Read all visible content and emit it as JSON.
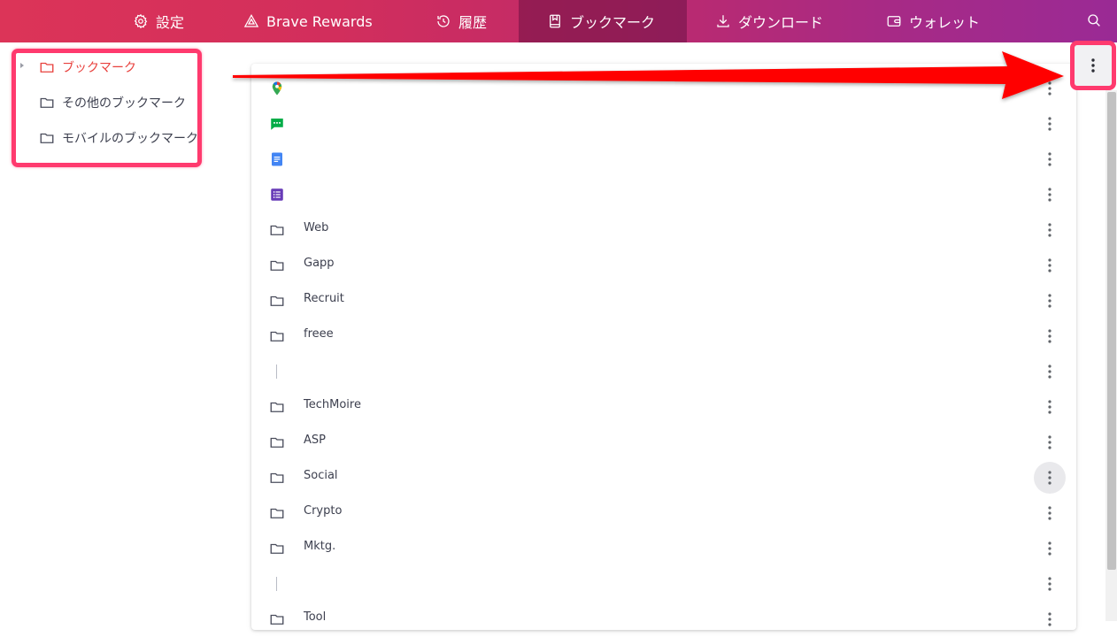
{
  "nav": {
    "settings": "設定",
    "rewards": "Brave Rewards",
    "history": "履歴",
    "bookmarks": "ブックマーク",
    "downloads": "ダウンロード",
    "wallet": "ウォレット"
  },
  "sidebar": {
    "items": [
      {
        "label": "ブックマーク"
      },
      {
        "label": "その他のブックマーク"
      },
      {
        "label": "モバイルのブックマーク"
      }
    ]
  },
  "list": {
    "rows": [
      {
        "type": "link",
        "icon": "google-maps-icon",
        "label": ""
      },
      {
        "type": "link",
        "icon": "google-chat-icon",
        "label": ""
      },
      {
        "type": "link",
        "icon": "google-docs-icon",
        "label": ""
      },
      {
        "type": "link",
        "icon": "google-forms-icon",
        "label": ""
      },
      {
        "type": "folder",
        "icon": "folder-icon",
        "label": "Web"
      },
      {
        "type": "folder",
        "icon": "folder-icon",
        "label": "Gapp"
      },
      {
        "type": "folder",
        "icon": "folder-icon",
        "label": "Recruit"
      },
      {
        "type": "folder",
        "icon": "folder-icon",
        "label": "freee"
      },
      {
        "type": "separator",
        "icon": "separator",
        "label": ""
      },
      {
        "type": "folder",
        "icon": "folder-icon",
        "label": "TechMoire"
      },
      {
        "type": "folder",
        "icon": "folder-icon",
        "label": "ASP"
      },
      {
        "type": "folder",
        "icon": "folder-icon",
        "label": "Social"
      },
      {
        "type": "folder",
        "icon": "folder-icon",
        "label": "Crypto"
      },
      {
        "type": "folder",
        "icon": "folder-icon",
        "label": "Mktg."
      },
      {
        "type": "separator",
        "icon": "separator",
        "label": ""
      },
      {
        "type": "folder",
        "icon": "folder-icon",
        "label": "Tool"
      }
    ]
  },
  "colors": {
    "accent_red": "#e8413d",
    "highlight_pink": "#ff3a6e",
    "arrow_red": "#ff0000"
  }
}
